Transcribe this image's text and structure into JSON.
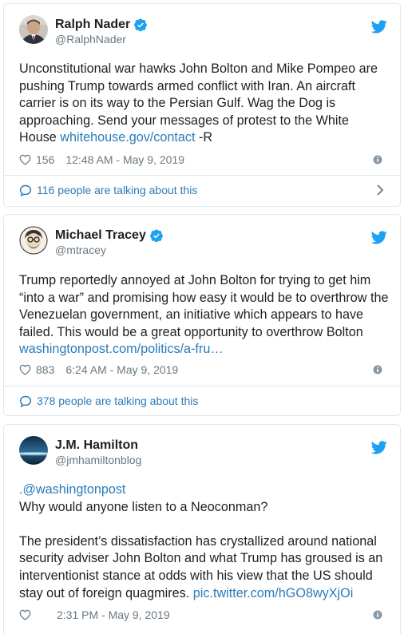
{
  "tweets": [
    {
      "display_name": "Ralph Nader",
      "handle": "@RalphNader",
      "verified": true,
      "text": "Unconstitutional war hawks John Bolton and Mike Pompeo are\npushing Trump towards armed conflict with Iran. An aircraft\ncarrier is on its way to the Persian Gulf. Wag the Dog is\napproaching. Send your messages of protest to the White\nHouse ",
      "link": "whitehouse.gov/contact",
      "text_after_link": " -R",
      "likes": "156",
      "timestamp": "12:48 AM - May 9, 2019",
      "talking": "116 people are talking about this"
    },
    {
      "display_name": "Michael Tracey",
      "handle": "@mtracey",
      "verified": true,
      "text": "Trump reportedly annoyed at John Bolton for trying to get him\n“into a war” and promising how easy it would be to overthrow the\nVenezuelan government, an initiative which appears to have\nfailed. This would be a great opportunity to overthrow Bolton\n",
      "link": "washingtonpost.com/politics/a-fru…",
      "text_after_link": "",
      "likes": "883",
      "timestamp": "6:24 AM - May 9, 2019",
      "talking": "378 people are talking about this"
    },
    {
      "display_name": "J.M. Hamilton",
      "handle": "@jmhamiltonblog",
      "verified": false,
      "mention": ".@washingtonpost",
      "text": "\nWhy would anyone listen to a Neoconman?\n\nThe president’s dissatisfaction has crystallized around national\nsecurity adviser John Bolton and what Trump has groused is an\ninterventionist stance at odds with his view that the US should\nstay out of foreign quagmires. ",
      "link": "pic.twitter.com/hGO8wyXjOi",
      "text_after_link": "",
      "likes": "",
      "timestamp": "2:31 PM - May 9, 2019"
    }
  ],
  "colors": {
    "link": "#2b7bb9",
    "verified": "#1da1f2",
    "bird": "#1da1f2",
    "muted": "#697882",
    "border": "#e1e8ed"
  },
  "icons": {
    "verified": "verified-badge-icon",
    "bird": "twitter-bird-icon",
    "heart": "heart-icon",
    "info": "info-icon",
    "bubble": "speech-bubble-icon",
    "chevron": "chevron-right-icon"
  }
}
